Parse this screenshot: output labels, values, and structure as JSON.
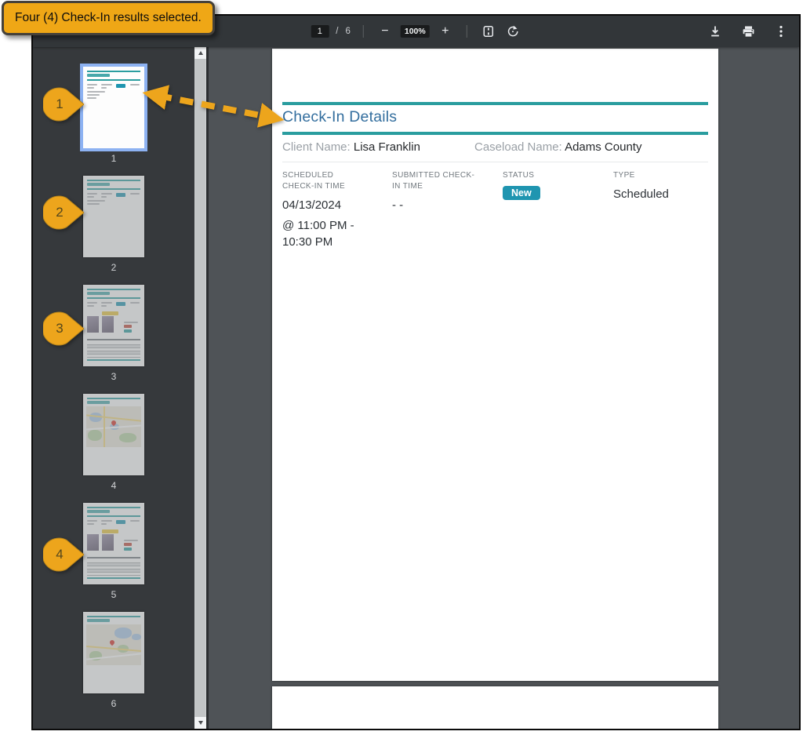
{
  "annotation": {
    "callout_text": "Four (4) Check-In results selected.",
    "markers": [
      "1",
      "2",
      "3",
      "4"
    ],
    "highlight_color": "#EFA716"
  },
  "toolbar": {
    "page_current": "1",
    "page_separator": "/",
    "page_total": "6",
    "zoom_out_label": "−",
    "zoom_level": "100%",
    "zoom_in_label": "+",
    "icons": {
      "fit_page": "fit-to-page-icon",
      "rotate": "rotate-counterclockwise-icon",
      "download": "download-icon",
      "print": "print-icon",
      "more": "more-options-icon"
    }
  },
  "sidebar": {
    "thumbnails": [
      {
        "page": "1",
        "selected": true,
        "kind": "details-summary"
      },
      {
        "page": "2",
        "selected": false,
        "kind": "details-summary"
      },
      {
        "page": "3",
        "selected": false,
        "kind": "details-photos"
      },
      {
        "page": "4",
        "selected": false,
        "kind": "map"
      },
      {
        "page": "5",
        "selected": false,
        "kind": "details-photos"
      },
      {
        "page": "6",
        "selected": false,
        "kind": "map"
      }
    ]
  },
  "document": {
    "title": "Check-In Details",
    "client": {
      "label": "Client Name:",
      "value": "Lisa Franklin"
    },
    "caseload": {
      "label": "Caseload Name:",
      "value": "Adams County"
    },
    "scheduled": {
      "label": "SCHEDULED CHECK-IN TIME",
      "date": "04/13/2024",
      "time_line1": "@ 11:00 PM -",
      "time_line2": "10:30 PM"
    },
    "submitted": {
      "label": "SUBMITTED CHECK-IN TIME",
      "value": "- -"
    },
    "status": {
      "label": "STATUS",
      "badge": "New"
    },
    "type": {
      "label": "TYPE",
      "value": "Scheduled"
    },
    "colors": {
      "accent_teal": "#2A9D9F",
      "title_blue": "#336E9E",
      "badge_teal": "#1F95B0"
    }
  }
}
